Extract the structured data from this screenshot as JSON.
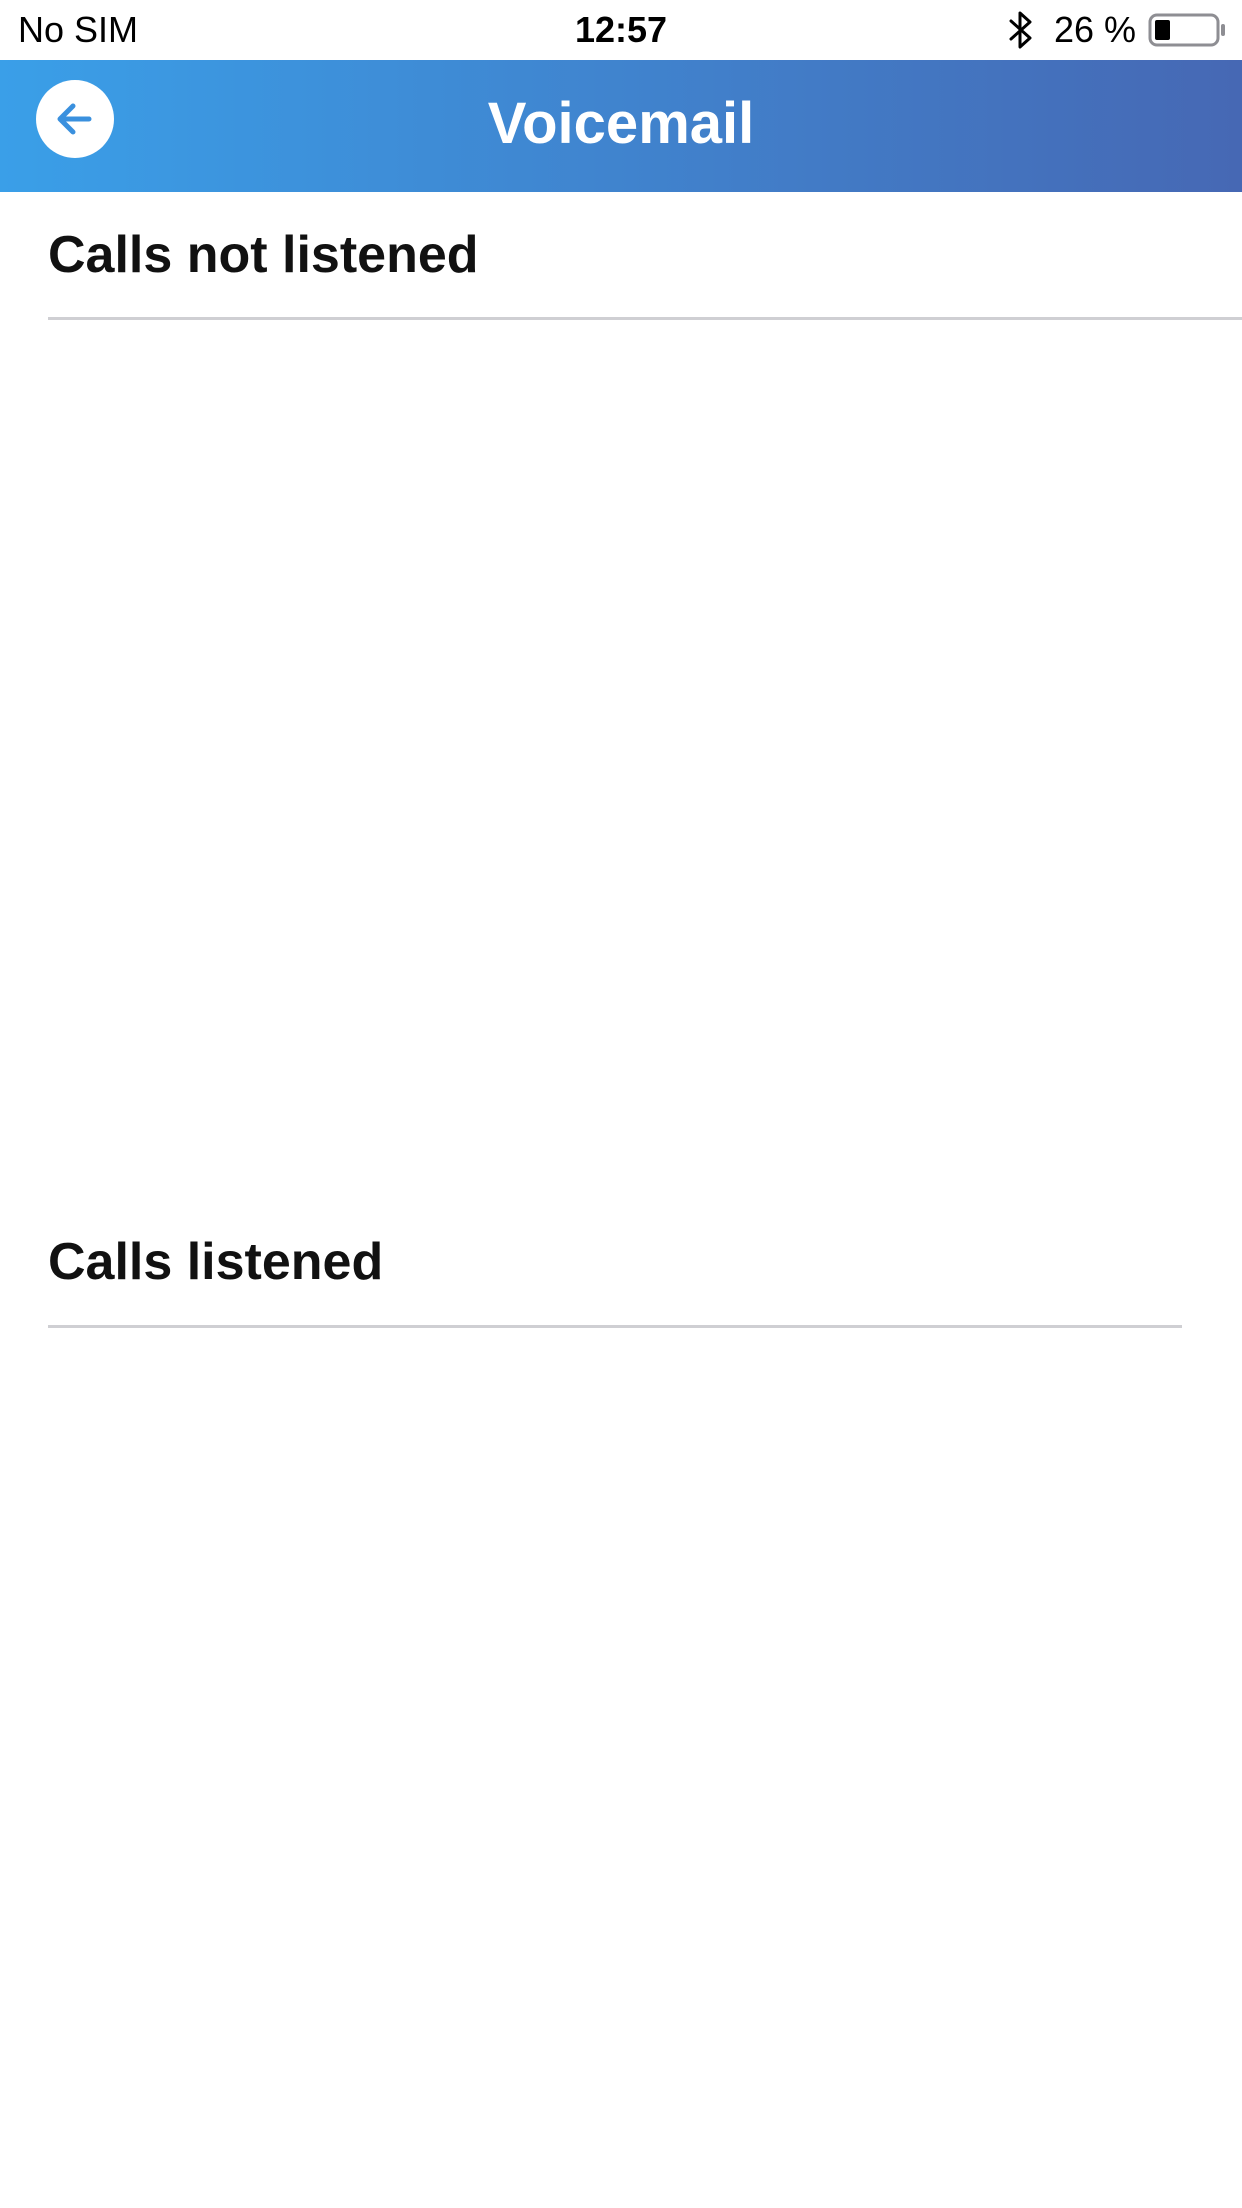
{
  "status_bar": {
    "carrier": "No SIM",
    "time": "12:57",
    "battery_percent": "26 %",
    "battery_level": 0.26,
    "bluetooth_icon": "bluetooth-icon"
  },
  "nav_bar": {
    "title": "Voicemail",
    "back_icon": "arrow-left-icon",
    "gradient_start": "#3a9fe8",
    "gradient_end": "#4668b4"
  },
  "sections": {
    "not_listened": {
      "title": "Calls not listened",
      "items": []
    },
    "listened": {
      "title": "Calls listened",
      "items": []
    }
  }
}
